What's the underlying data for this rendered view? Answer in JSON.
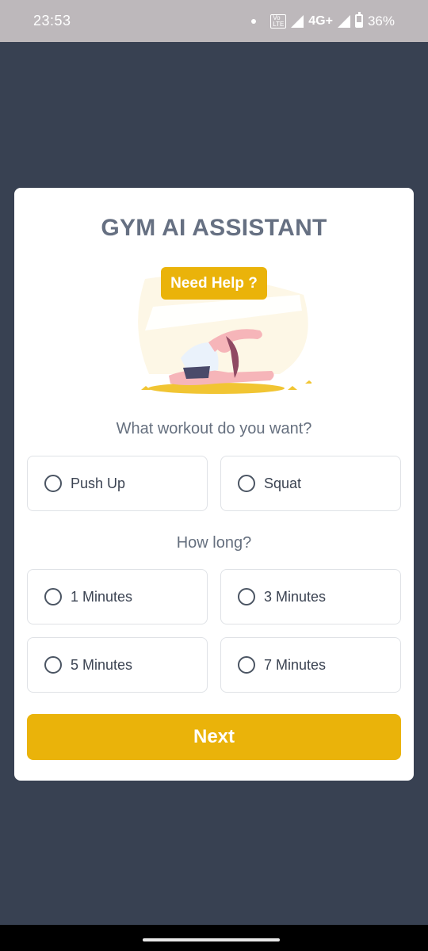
{
  "status_bar": {
    "time": "23:53",
    "network": "4G+",
    "volte": "Vo LTE",
    "battery": "36%"
  },
  "app": {
    "title": "GYM AI ASSISTANT",
    "help_label": "Need Help ?"
  },
  "workout": {
    "question": "What workout do you want?",
    "options": [
      {
        "label": "Push Up",
        "selected": false
      },
      {
        "label": "Squat",
        "selected": false
      }
    ]
  },
  "duration": {
    "question": "How long?",
    "options": [
      {
        "label": "1 Minutes",
        "selected": false
      },
      {
        "label": "3 Minutes",
        "selected": false
      },
      {
        "label": "5 Minutes",
        "selected": false
      },
      {
        "label": "7 Minutes",
        "selected": false
      }
    ]
  },
  "actions": {
    "next_label": "Next"
  },
  "colors": {
    "background": "#384152",
    "accent": "#eab30a",
    "title": "#667082",
    "card": "#ffffff"
  }
}
